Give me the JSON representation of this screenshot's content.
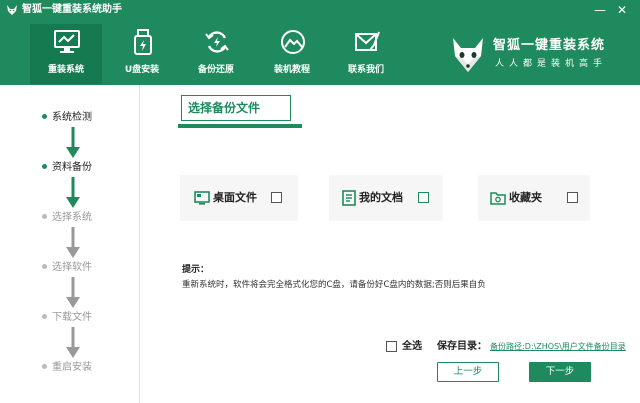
{
  "titlebar": {
    "title": "智狐一键重装系统助手",
    "minimize": "—",
    "close": "✕"
  },
  "nav": [
    {
      "label": "重装系统",
      "icon": "monitor-icon",
      "active": true
    },
    {
      "label": "U盘安装",
      "icon": "usb-drive-icon",
      "active": false
    },
    {
      "label": "备份还原",
      "icon": "refresh-icon",
      "active": false
    },
    {
      "label": "装机教程",
      "icon": "mountain-image-icon",
      "active": false
    },
    {
      "label": "联系我们",
      "icon": "mail-icon",
      "active": false
    }
  ],
  "brand": {
    "name": "智狐一键重装系统",
    "slogan": "人人都是装机高手"
  },
  "steps": [
    {
      "label": "系统检测",
      "state": "done"
    },
    {
      "label": "资料备份",
      "state": "done"
    },
    {
      "label": "选择系统",
      "state": "todo"
    },
    {
      "label": "选择软件",
      "state": "todo"
    },
    {
      "label": "下载文件",
      "state": "todo"
    },
    {
      "label": "重启安装",
      "state": "todo"
    }
  ],
  "main": {
    "section_title": "选择备份文件",
    "options": [
      {
        "label": "桌面文件",
        "icon": "desktop-icon"
      },
      {
        "label": "我的文档",
        "icon": "document-icon"
      },
      {
        "label": "收藏夹",
        "icon": "favorites-folder-icon"
      }
    ],
    "tip_title": "提示：",
    "tip_text": "重新系统时，软件将会完全格式化您的C盘，请备份好C盘内的数据;否则后果自负",
    "select_all": "全选",
    "save_dir_label": "保存目录：",
    "save_dir_path": "备份路径:D:\\ZHOS\\用户文件备份目录",
    "prev_button": "上一步",
    "next_button": "下一步"
  },
  "colors": {
    "brand_green": "#1e8a5e",
    "active_nav": "#167a51",
    "inactive_step": "#999999"
  }
}
